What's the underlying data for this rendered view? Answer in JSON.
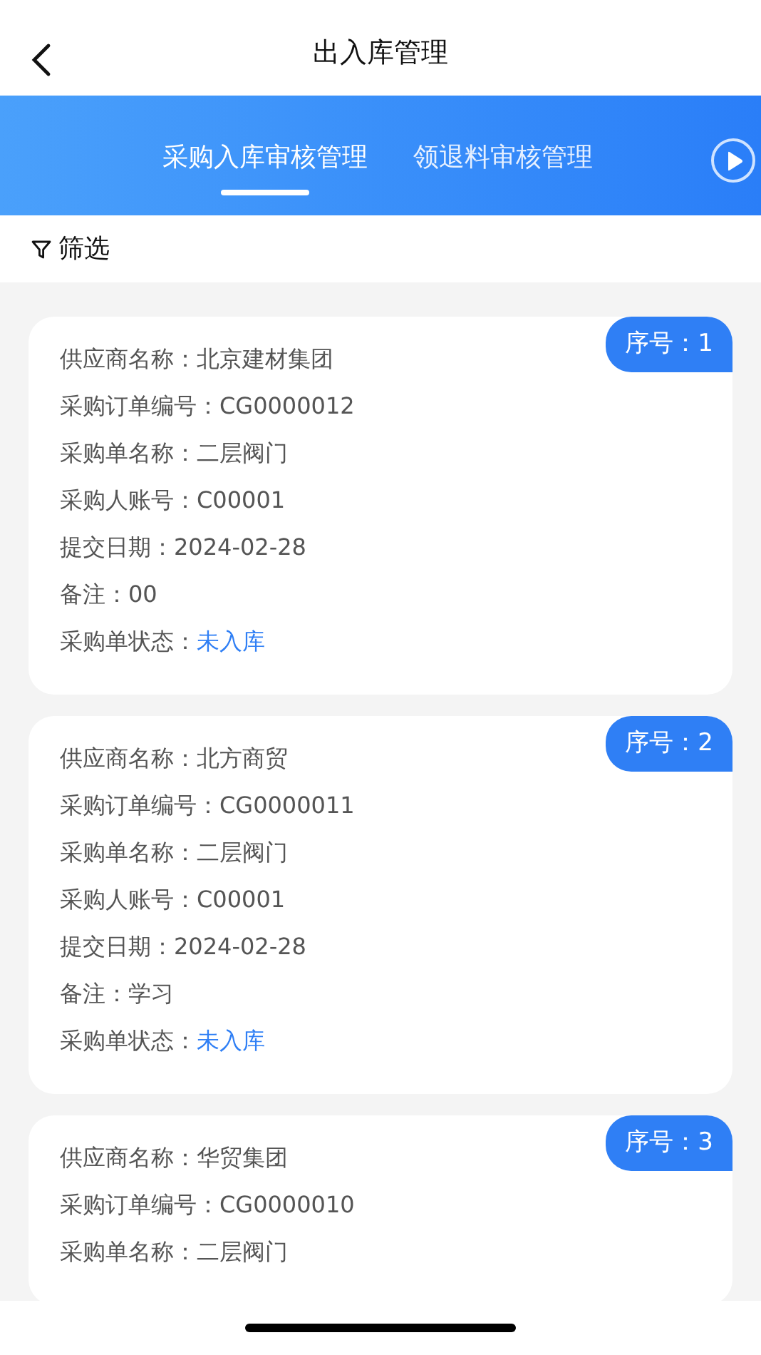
{
  "header": {
    "title": "出入库管理"
  },
  "tabs": [
    {
      "label": "采购入库审核管理",
      "selected": true
    },
    {
      "label": "领退料审核管理",
      "selected": false
    }
  ],
  "filter": {
    "label": "筛选"
  },
  "records": [
    {
      "badge": "序号：1",
      "fields": [
        {
          "kind": "plain",
          "label": "供应商名称：",
          "value": "北京建材集团"
        },
        {
          "kind": "plain",
          "label": "采购订单编号：",
          "value": "CG0000012"
        },
        {
          "kind": "plain",
          "label": "采购单名称：",
          "value": "二层阀门"
        },
        {
          "kind": "plain",
          "label": "采购人账号：",
          "value": "C00001"
        },
        {
          "kind": "plain",
          "label": "提交日期：",
          "value": "2024-02-28"
        },
        {
          "kind": "plain",
          "label": "备注：",
          "value": "00"
        },
        {
          "kind": "status",
          "label": "采购单状态：",
          "value": "未入库"
        }
      ]
    },
    {
      "badge": "序号：2",
      "fields": [
        {
          "kind": "plain",
          "label": "供应商名称：",
          "value": "北方商贸"
        },
        {
          "kind": "plain",
          "label": "采购订单编号：",
          "value": "CG0000011"
        },
        {
          "kind": "plain",
          "label": "采购单名称：",
          "value": "二层阀门"
        },
        {
          "kind": "plain",
          "label": "采购人账号：",
          "value": "C00001"
        },
        {
          "kind": "plain",
          "label": "提交日期：",
          "value": "2024-02-28"
        },
        {
          "kind": "plain",
          "label": "备注：",
          "value": "学习"
        },
        {
          "kind": "status",
          "label": "采购单状态：",
          "value": "未入库"
        }
      ]
    },
    {
      "badge": "序号：3",
      "fields": [
        {
          "kind": "plain",
          "label": "供应商名称：",
          "value": "华贸集团"
        },
        {
          "kind": "plain",
          "label": "采购订单编号：",
          "value": "CG0000010"
        },
        {
          "kind": "plain",
          "label": "采购单名称：",
          "value": "二层阀门"
        }
      ]
    }
  ]
}
